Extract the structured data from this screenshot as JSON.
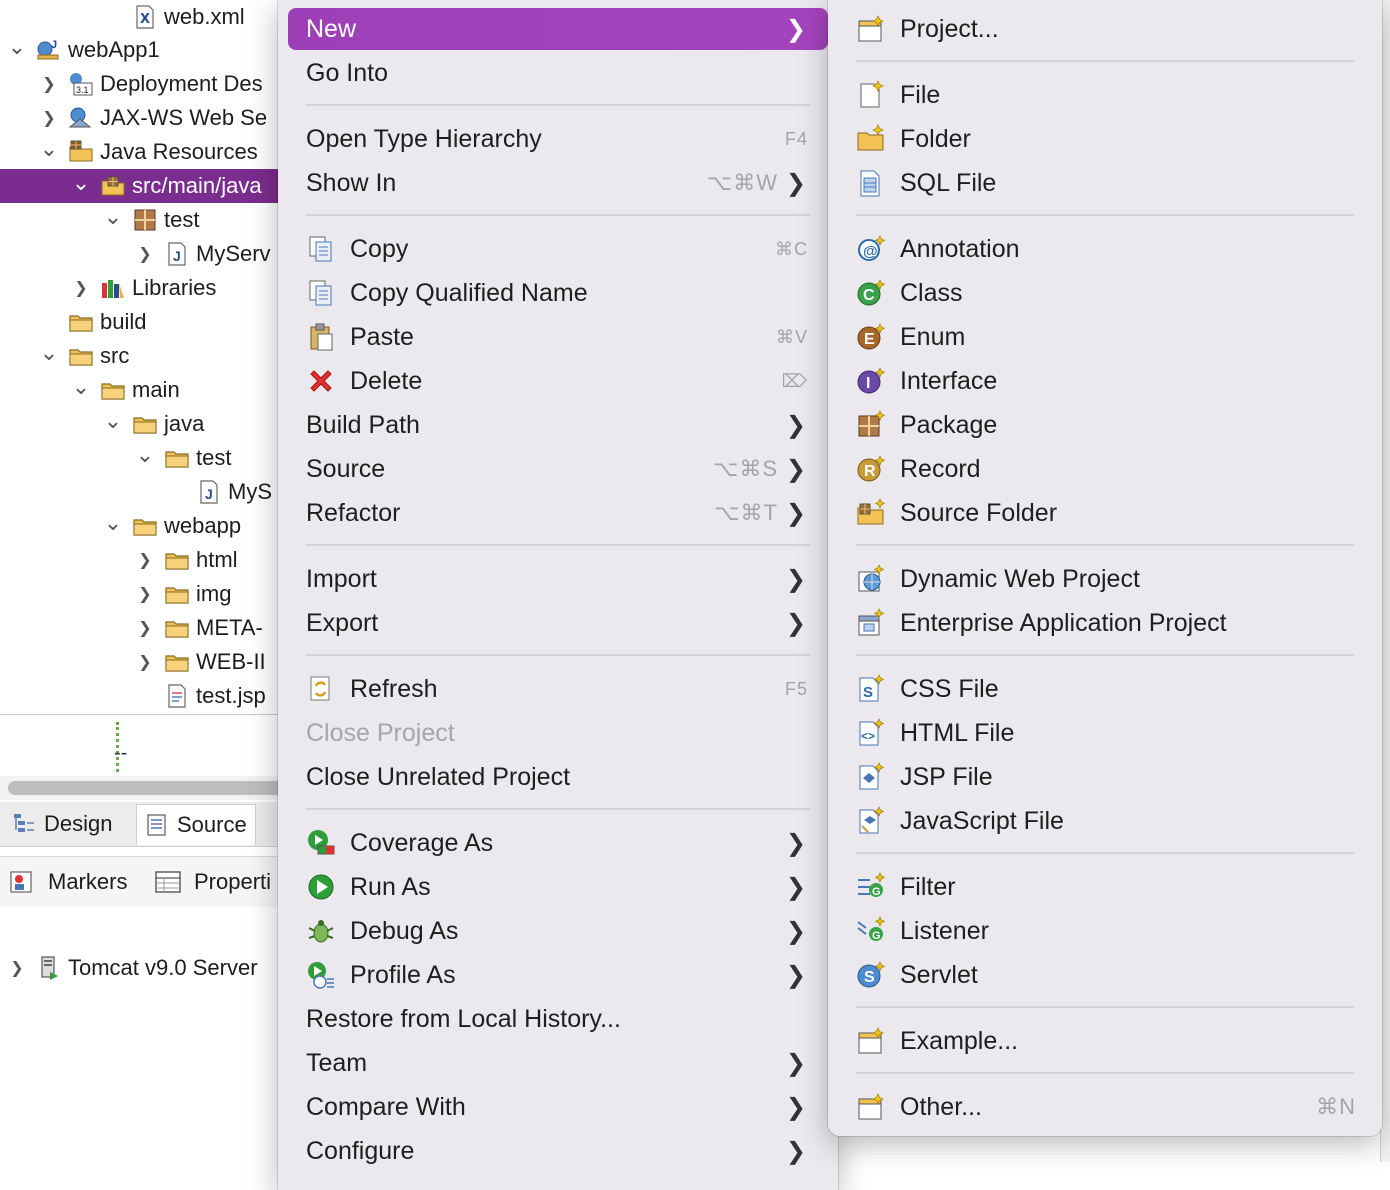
{
  "tree": {
    "items": [
      {
        "label": "web.xml",
        "icon": "xml-file-icon",
        "expanded": null
      },
      {
        "label": "webApp1",
        "icon": "web-project-icon",
        "expanded": true
      },
      {
        "label": "Deployment Des",
        "icon": "deployment-descriptor-icon",
        "expanded": false
      },
      {
        "label": "JAX-WS Web Se",
        "icon": "jaxws-icon",
        "expanded": false
      },
      {
        "label": "Java Resources",
        "icon": "java-resources-icon",
        "expanded": true
      },
      {
        "label": "src/main/java",
        "icon": "source-folder-icon",
        "expanded": true
      },
      {
        "label": "test",
        "icon": "package-icon",
        "expanded": true
      },
      {
        "label": "MyServ",
        "icon": "java-file-icon",
        "expanded": false
      },
      {
        "label": "Libraries",
        "icon": "libraries-icon",
        "expanded": false
      },
      {
        "label": "build",
        "icon": "folder-icon",
        "expanded": null
      },
      {
        "label": "src",
        "icon": "folder-icon",
        "expanded": true
      },
      {
        "label": "main",
        "icon": "folder-icon",
        "expanded": true
      },
      {
        "label": "java",
        "icon": "folder-icon",
        "expanded": true
      },
      {
        "label": "test",
        "icon": "folder-icon",
        "expanded": true
      },
      {
        "label": "MyS",
        "icon": "java-file-icon",
        "expanded": null
      },
      {
        "label": "webapp",
        "icon": "folder-icon",
        "expanded": true
      },
      {
        "label": "html",
        "icon": "folder-icon",
        "expanded": false
      },
      {
        "label": "img",
        "icon": "folder-icon",
        "expanded": false
      },
      {
        "label": "META-",
        "icon": "folder-icon",
        "expanded": false
      },
      {
        "label": "WEB-II",
        "icon": "folder-icon",
        "expanded": false
      },
      {
        "label": "test.jsp",
        "icon": "jsp-file-icon",
        "expanded": null
      }
    ],
    "selected_label": "src/main/java"
  },
  "dotted_marker": "--",
  "editor_tabs": [
    {
      "label": "Design",
      "icon": "design-icon"
    },
    {
      "label": "Source",
      "icon": "source-icon"
    }
  ],
  "views": [
    {
      "label": "Markers",
      "icon": "markers-icon"
    },
    {
      "label": "Properti",
      "icon": "properties-icon"
    }
  ],
  "servers": {
    "label": "Tomcat v9.0 Server",
    "icon": "server-icon"
  },
  "context_menu": {
    "items": [
      {
        "label": "New",
        "shortcut": "",
        "submenu": true,
        "icon": ""
      },
      {
        "label": "Go Into",
        "shortcut": "",
        "submenu": false,
        "icon": ""
      },
      {
        "label": "Open Type Hierarchy",
        "shortcut": "F4",
        "submenu": false,
        "icon": ""
      },
      {
        "label": "Show In",
        "shortcut": "⌥⌘W",
        "submenu": true,
        "icon": ""
      },
      {
        "label": "Copy",
        "shortcut": "⌘C",
        "submenu": false,
        "icon": "copy-icon"
      },
      {
        "label": "Copy Qualified Name",
        "shortcut": "",
        "submenu": false,
        "icon": "copy-qualified-name-icon"
      },
      {
        "label": "Paste",
        "shortcut": "⌘V",
        "submenu": false,
        "icon": "paste-icon"
      },
      {
        "label": "Delete",
        "shortcut": "⌦",
        "submenu": false,
        "icon": "delete-icon"
      },
      {
        "label": "Build Path",
        "shortcut": "",
        "submenu": true,
        "icon": ""
      },
      {
        "label": "Source",
        "shortcut": "⌥⌘S",
        "submenu": true,
        "icon": ""
      },
      {
        "label": "Refactor",
        "shortcut": "⌥⌘T",
        "submenu": true,
        "icon": ""
      },
      {
        "label": "Import",
        "shortcut": "",
        "submenu": true,
        "icon": ""
      },
      {
        "label": "Export",
        "shortcut": "",
        "submenu": true,
        "icon": ""
      },
      {
        "label": "Refresh",
        "shortcut": "F5",
        "submenu": false,
        "icon": "refresh-icon"
      },
      {
        "label": "Close Project",
        "shortcut": "",
        "submenu": false,
        "icon": "",
        "disabled": true
      },
      {
        "label": "Close Unrelated Project",
        "shortcut": "",
        "submenu": false,
        "icon": ""
      },
      {
        "label": "Coverage As",
        "shortcut": "",
        "submenu": true,
        "icon": "coverage-icon"
      },
      {
        "label": "Run As",
        "shortcut": "",
        "submenu": true,
        "icon": "run-icon"
      },
      {
        "label": "Debug As",
        "shortcut": "",
        "submenu": true,
        "icon": "debug-icon"
      },
      {
        "label": "Profile As",
        "shortcut": "",
        "submenu": true,
        "icon": "profile-icon"
      },
      {
        "label": "Restore from Local History...",
        "shortcut": "",
        "submenu": false,
        "icon": ""
      },
      {
        "label": "Team",
        "shortcut": "",
        "submenu": true,
        "icon": ""
      },
      {
        "label": "Compare With",
        "shortcut": "",
        "submenu": true,
        "icon": ""
      },
      {
        "label": "Configure",
        "shortcut": "",
        "submenu": true,
        "icon": ""
      }
    ]
  },
  "new_submenu": {
    "items": [
      {
        "label": "Project...",
        "icon": "new-project-icon"
      },
      {
        "label": "File",
        "icon": "new-file-icon"
      },
      {
        "label": "Folder",
        "icon": "new-folder-icon"
      },
      {
        "label": "SQL File",
        "icon": "sql-file-icon"
      },
      {
        "label": "Annotation",
        "icon": "annotation-icon"
      },
      {
        "label": "Class",
        "icon": "class-icon"
      },
      {
        "label": "Enum",
        "icon": "enum-icon"
      },
      {
        "label": "Interface",
        "icon": "interface-icon"
      },
      {
        "label": "Package",
        "icon": "package-icon"
      },
      {
        "label": "Record",
        "icon": "record-icon"
      },
      {
        "label": "Source Folder",
        "icon": "source-folder-icon"
      },
      {
        "label": "Dynamic Web Project",
        "icon": "dynamic-web-project-icon"
      },
      {
        "label": "Enterprise Application Project",
        "icon": "enterprise-app-icon"
      },
      {
        "label": "CSS File",
        "icon": "css-file-icon"
      },
      {
        "label": "HTML File",
        "icon": "html-file-icon"
      },
      {
        "label": "JSP File",
        "icon": "jsp-file-icon"
      },
      {
        "label": "JavaScript File",
        "icon": "javascript-file-icon"
      },
      {
        "label": "Filter",
        "icon": "filter-icon"
      },
      {
        "label": "Listener",
        "icon": "listener-icon"
      },
      {
        "label": "Servlet",
        "icon": "servlet-icon"
      },
      {
        "label": "Example...",
        "icon": "example-icon"
      },
      {
        "label": "Other...",
        "icon": "other-icon",
        "shortcut": "⌘N"
      }
    ]
  },
  "colors": {
    "selection": "#7b2c8f",
    "menu_highlight": "#a040ba",
    "menu_bg": "#ebe9ee"
  }
}
